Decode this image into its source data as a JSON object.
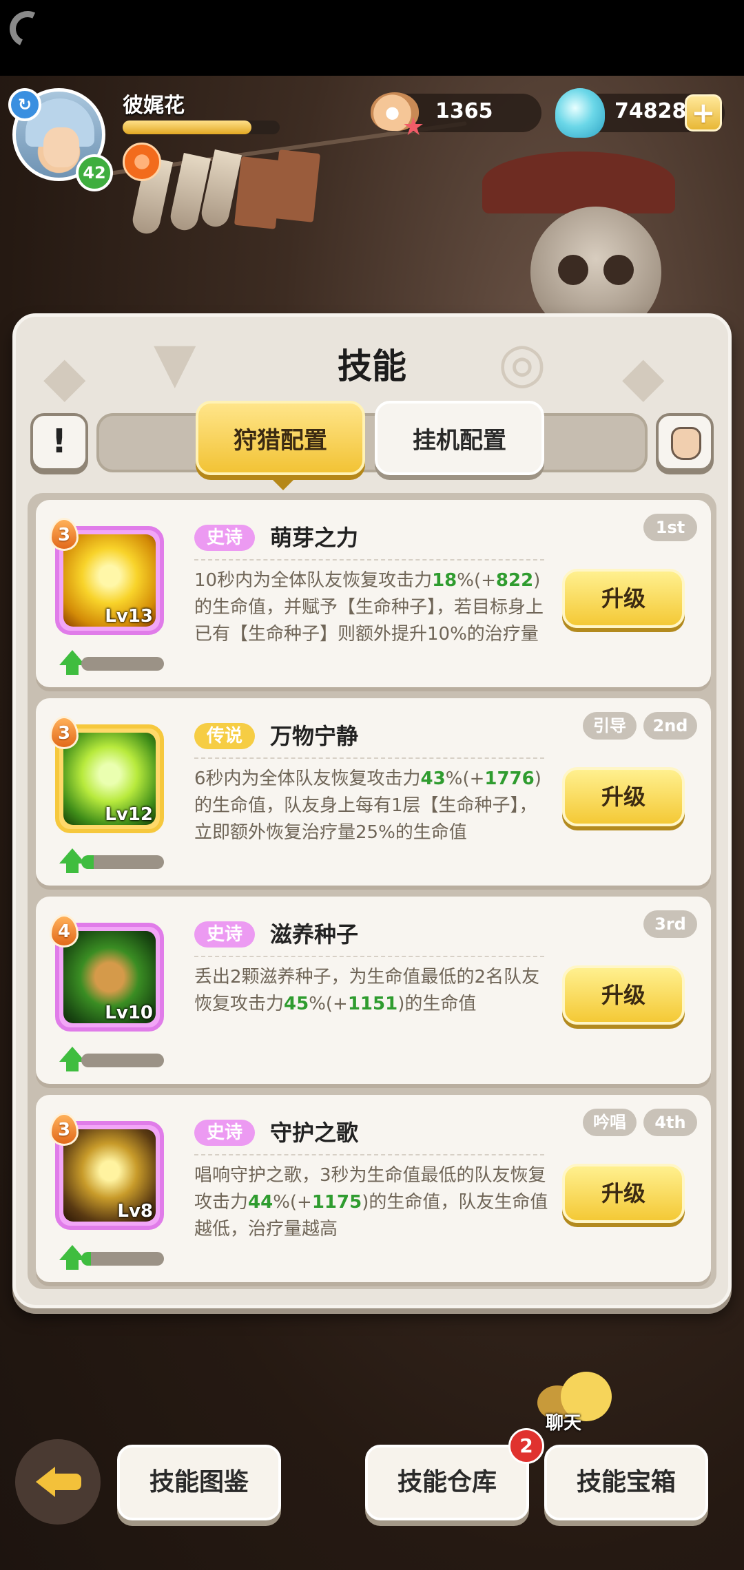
{
  "player": {
    "name": "彼娓花",
    "level": "42",
    "xp_fraction": 0.82
  },
  "currency": {
    "pearls": "1365",
    "gems": "74828"
  },
  "panel": {
    "title": "技能"
  },
  "tabs": [
    {
      "label": "狩猎配置",
      "active": true
    },
    {
      "label": "挂机配置",
      "active": false
    }
  ],
  "skills": [
    {
      "rank": "3",
      "level": "Lv13",
      "rarity": "史诗",
      "name": "萌芽之力",
      "order": "1st",
      "tag": "",
      "desc_parts": [
        "10秒内为全体队友恢复攻击力",
        "18",
        "%(+",
        "822",
        ")的生命值，并赋予【生命种子】，若目标身上已有【生命种子】则额外提升10%的治疗量"
      ],
      "progress": 0.0,
      "button": "升级"
    },
    {
      "rank": "3",
      "level": "Lv12",
      "rarity": "传说",
      "name": "万物宁静",
      "order": "2nd",
      "tag": "引导",
      "desc_parts": [
        "6秒内为全体队友恢复攻击力",
        "43",
        "%(+",
        "1776",
        ")的生命值，队友身上每有1层【生命种子】，立即额外恢复治疗量25%的生命值"
      ],
      "progress": 0.15,
      "button": "升级"
    },
    {
      "rank": "4",
      "level": "Lv10",
      "rarity": "史诗",
      "name": "滋养种子",
      "order": "3rd",
      "tag": "",
      "desc_parts": [
        "丢出2颗滋养种子，为生命值最低的2名队友恢复攻击力",
        "45",
        "%(+",
        "1151",
        ")的生命值"
      ],
      "progress": 0.0,
      "button": "升级"
    },
    {
      "rank": "3",
      "level": "Lv8",
      "rarity": "史诗",
      "name": "守护之歌",
      "order": "4th",
      "tag": "吟唱",
      "desc_parts": [
        "唱响守护之歌，3秒为生命值最低的队友恢复攻击力",
        "44",
        "%(+",
        "1175",
        ")的生命值，队友生命值越低，治疗量越高"
      ],
      "progress": 0.12,
      "button": "升级"
    }
  ],
  "bottom": {
    "buttons": [
      "技能图鉴",
      "技能仓库",
      "技能宝箱"
    ],
    "notification": "2",
    "chat": "聊天"
  },
  "colors": {
    "accent_yellow": "#f4c936",
    "epic": "#e07ce9",
    "legend": "#f6c83d",
    "green": "#2f9c2f"
  },
  "icons": [
    "refresh-icon",
    "buff-icon",
    "pearl-icon",
    "gem-icon",
    "plus-icon",
    "info-icon",
    "hand-icon",
    "rank-flame-icon",
    "upgrade-arrow-icon",
    "back-arrow-icon",
    "chat-icon"
  ]
}
